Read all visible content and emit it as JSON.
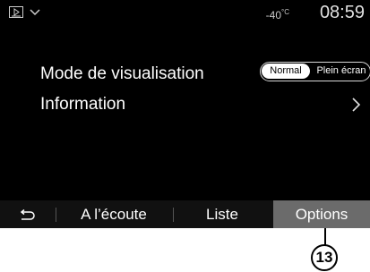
{
  "status": {
    "temperature": "-40",
    "temperature_unit": "°C",
    "time": "08:59"
  },
  "settings": {
    "display_mode_label": "Mode de visualisation",
    "display_mode_options": [
      "Normal",
      "Plein écran"
    ],
    "display_mode_selected": "Normal",
    "information_label": "Information"
  },
  "bottom_bar": {
    "listen_label": "A l’écoute",
    "list_label": "Liste",
    "options_label": "Options"
  },
  "callout": {
    "number": "13"
  },
  "colors": {
    "screen_bg": "#000000",
    "active_tab": "#6b6b6b"
  }
}
